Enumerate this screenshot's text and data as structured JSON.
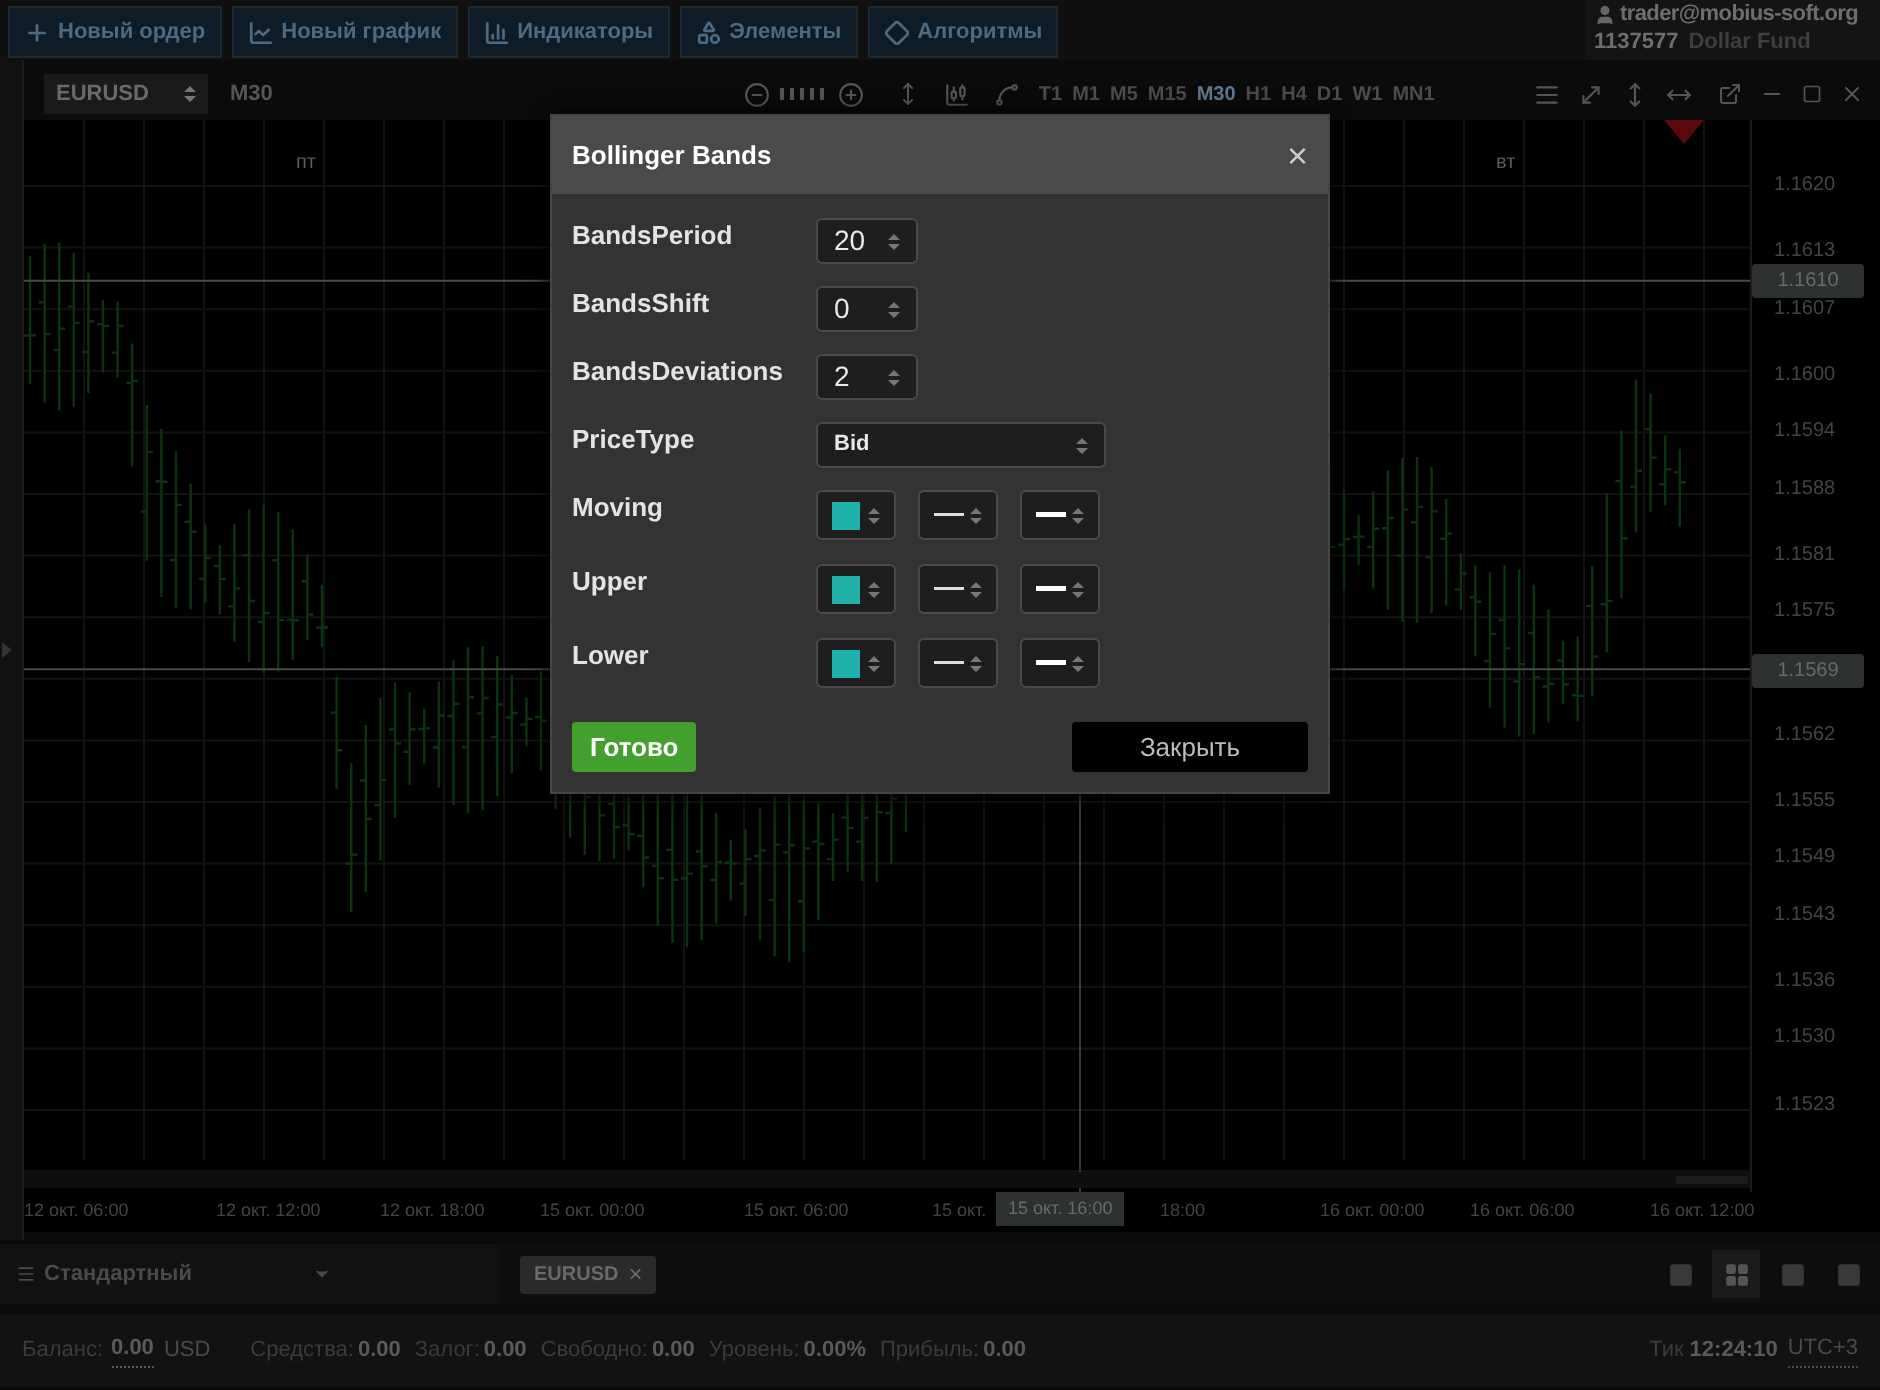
{
  "toolbar": {
    "buttons": [
      {
        "label": "Новый ордер"
      },
      {
        "label": "Новый график"
      },
      {
        "label": "Индикаторы"
      },
      {
        "label": "Элементы"
      },
      {
        "label": "Алгоритмы"
      }
    ]
  },
  "account": {
    "email": "trader@mobius-soft.org",
    "number": "1137577",
    "name": "Dollar Fund"
  },
  "chart_toolbar": {
    "symbol": "EURUSD",
    "period": "M30",
    "timeframes": [
      {
        "label": "T1",
        "selected": false
      },
      {
        "label": "M1",
        "selected": false
      },
      {
        "label": "M5",
        "selected": false
      },
      {
        "label": "M15",
        "selected": false
      },
      {
        "label": "M30",
        "selected": true
      },
      {
        "label": "H1",
        "selected": false
      },
      {
        "label": "H4",
        "selected": false
      },
      {
        "label": "D1",
        "selected": false
      },
      {
        "label": "W1",
        "selected": false
      },
      {
        "label": "MN1",
        "selected": false
      }
    ]
  },
  "chart": {
    "day_labels": [
      "пт",
      "вт"
    ],
    "price_labels": [
      "1.1620",
      "1.1613",
      "1.1607",
      "1.1600",
      "1.1594",
      "1.1588",
      "1.1581",
      "1.1575",
      "1.1562",
      "1.1555",
      "1.1549",
      "1.1543",
      "1.1536",
      "1.1530",
      "1.1523"
    ],
    "price_markers": [
      "1.1610",
      "1.1569"
    ],
    "time_labels": [
      "12 окт. 06:00",
      "12 окт. 12:00",
      "12 окт. 18:00",
      "15 окт. 00:00",
      "15 окт. 06:00",
      "15 окт.",
      "18:00",
      "16 окт. 00:00",
      "16 окт. 06:00",
      "16 окт. 12:00"
    ],
    "cursor_time": "15 окт. 16:00"
  },
  "bottom": {
    "layout": "Стандартный",
    "tabs": [
      {
        "label": "EURUSD",
        "close": "×"
      }
    ],
    "layout_buttons": [
      {
        "selected": false
      },
      {
        "selected": true
      },
      {
        "selected": false
      },
      {
        "selected": false
      }
    ]
  },
  "status_bar": {
    "items": [
      {
        "label": "Баланс:",
        "value": "0.00",
        "unit": "USD"
      },
      {
        "label": "Средства:",
        "value": "0.00"
      },
      {
        "label": "Залог:",
        "value": "0.00"
      },
      {
        "label": "Свободно:",
        "value": "0.00"
      },
      {
        "label": "Уровень:",
        "value": "0.00%"
      },
      {
        "label": "Прибыль:",
        "value": "0.00"
      }
    ],
    "tick_label": "Тик",
    "time": "12:24:10",
    "timezone": "UTC+3"
  },
  "dialog": {
    "title": "Bollinger Bands",
    "close": "×",
    "fields": [
      {
        "kind": "number",
        "label": "BandsPeriod",
        "value": "20"
      },
      {
        "kind": "number",
        "label": "BandsShift",
        "value": "0"
      },
      {
        "kind": "number",
        "label": "BandsDeviations",
        "value": "2"
      },
      {
        "kind": "select",
        "label": "PriceType",
        "value": "Bid"
      },
      {
        "kind": "style",
        "label": "Moving",
        "color": "#20b2aa"
      },
      {
        "kind": "style",
        "label": "Upper",
        "color": "#20b2aa"
      },
      {
        "kind": "style",
        "label": "Lower",
        "color": "#20b2aa"
      }
    ],
    "buttons": [
      {
        "kind": "primary",
        "label": "Готово"
      },
      {
        "kind": "secondary",
        "label": "Закрыть"
      }
    ]
  }
}
